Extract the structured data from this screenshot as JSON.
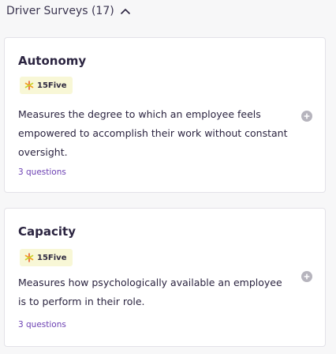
{
  "section": {
    "title": "Driver Surveys (17)",
    "toggle_icon": "chevron-up-icon"
  },
  "colors": {
    "accent_purple": "#6b3fb2",
    "badge_bg": "#f8f7d6",
    "info_icon_bg": "#b6b4bd"
  },
  "surveys": [
    {
      "title": "Autonomy",
      "badge": "15Five",
      "badge_icon": "star-logo-icon",
      "description": "Measures the degree to which an employee feels empowered to accomplish their work without constant oversight.",
      "questions": "3 questions",
      "action_icon": "info-icon"
    },
    {
      "title": "Capacity",
      "badge": "15Five",
      "badge_icon": "star-logo-icon",
      "description": "Measures how psychologically available an employee is to perform in their role.",
      "questions": "3 questions",
      "action_icon": "info-icon"
    }
  ]
}
